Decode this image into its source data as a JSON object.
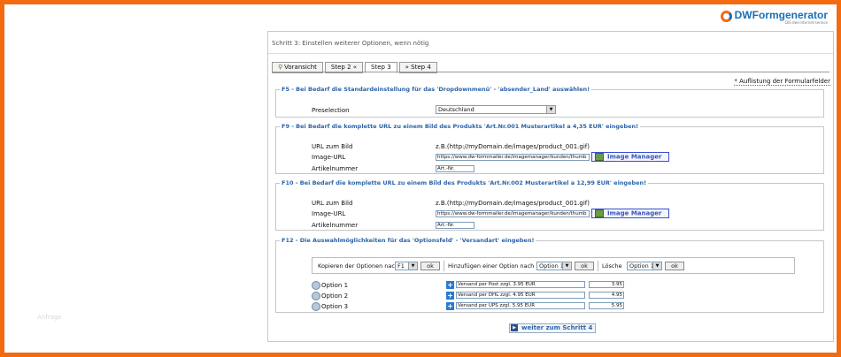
{
  "brand": {
    "name_prefix": "DW",
    "name_suffix": "Formgenerator",
    "tagline": "DIS dwi-internet-service"
  },
  "ghost_text": "Anfrage",
  "step_title": "Schritt 3: Einstellen weiterer Optionen, wenn nötig",
  "tabs": [
    {
      "label": "Voransicht",
      "icon": "preview-icon"
    },
    {
      "label": "Step 2 «"
    },
    {
      "label": "Step 3"
    },
    {
      "label": "» Step 4"
    }
  ],
  "auflistung_link": "* Auflistung der Formularfelder",
  "f5": {
    "legend": "F5 - Bei Bedarf die Standardeinstellung für das 'Dropdownmenü' - 'absender_Land' auswählen!",
    "preselection_label": "Preselection",
    "preselection_value": "Deutschland"
  },
  "f9": {
    "legend": "F9 - Bei Bedarf die komplette URL zu einem Bild des Produkts 'Art.Nr.001 Musterartikel a 4,35 EUR' eingeben!",
    "url_label": "URL zum Bild",
    "url_example": "z.B.(http://myDomain.de/images/product_001.gif)",
    "image_url_label": "Image-URL",
    "image_url_value": "https://www.dw-formmailer.de/imagemanager/kunden/thumb",
    "image_manager_label": "Image Manager",
    "artnr_label": "Artikelnummer",
    "artnr_value": "Art.-Nr."
  },
  "f10": {
    "legend": "F10 - Bei Bedarf die komplette URL zu einem Bild des Produkts 'Art.Nr.002 Musterartikel a 12,99 EUR' eingeben!",
    "url_label": "URL zum Bild",
    "url_example": "z.B.(http://myDomain.de/images/product_001.gif)",
    "image_url_label": "Image-URL",
    "image_url_value": "https://www.dw-formmailer.de/imagemanager/kunden/thumb",
    "image_manager_label": "Image Manager",
    "artnr_label": "Artikelnummer",
    "artnr_value": "Art.-Nr."
  },
  "f12": {
    "legend": "F12 - Die Auswahlmöglichkeiten für das 'Optionsfeld' - 'Versandart' eingeben!",
    "copy_label": "Kopieren der Optionen nach",
    "copy_select": "F1",
    "add_label": "Hinzufügen einer Option nach",
    "add_select": "Option 1",
    "delete_label": "Lösche",
    "delete_select": "Option 1",
    "ok_label": "ok",
    "options": [
      {
        "label": "Option 1",
        "text": "Versand per Post zzgl. 3.95 EUR",
        "price": "3.95"
      },
      {
        "label": "Option 2",
        "text": "Versand per DHL zzgl. 4.95 EUR",
        "price": "4.95"
      },
      {
        "label": "Option 3",
        "text": "Versand per UPS zzgl. 5.95 EUR",
        "price": "5.95"
      }
    ]
  },
  "next_button": "weiter zum Schritt 4"
}
